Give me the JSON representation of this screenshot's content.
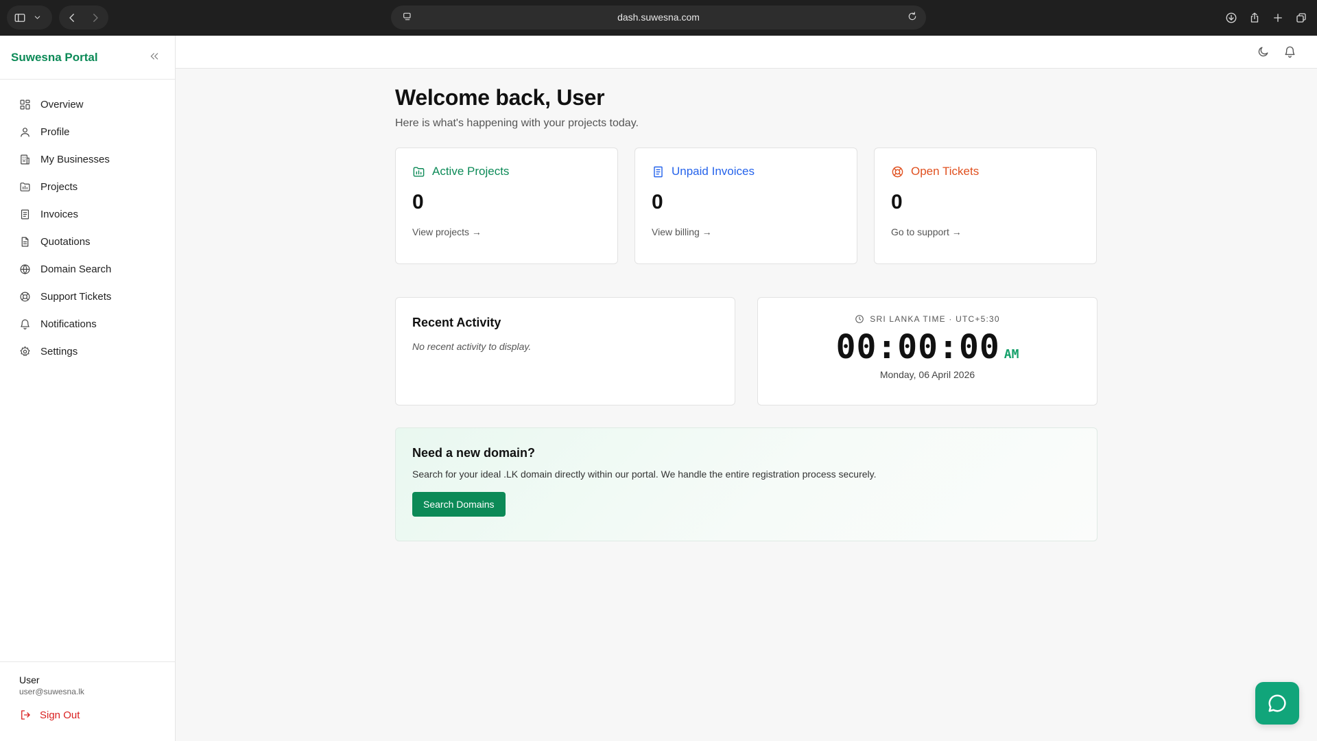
{
  "browser": {
    "url": "dash.suwesna.com"
  },
  "sidebar": {
    "brand": "Suwesna Portal",
    "items": [
      {
        "label": "Overview",
        "icon": "grid-icon"
      },
      {
        "label": "Profile",
        "icon": "user-icon"
      },
      {
        "label": "My Businesses",
        "icon": "building-icon"
      },
      {
        "label": "Projects",
        "icon": "folder-chart-icon"
      },
      {
        "label": "Invoices",
        "icon": "receipt-icon"
      },
      {
        "label": "Quotations",
        "icon": "document-icon"
      },
      {
        "label": "Domain Search",
        "icon": "globe-icon"
      },
      {
        "label": "Support Tickets",
        "icon": "lifebuoy-icon"
      },
      {
        "label": "Notifications",
        "icon": "bell-icon"
      },
      {
        "label": "Settings",
        "icon": "gear-icon"
      }
    ],
    "user_name": "User",
    "user_email": "user@suwesna.lk",
    "sign_out": "Sign Out"
  },
  "main": {
    "title": "Welcome back, User",
    "subtitle": "Here is what's happening with your projects today.",
    "cards": [
      {
        "label": "Active Projects",
        "value": "0",
        "link": "View projects →",
        "color": "#0c8a57"
      },
      {
        "label": "Unpaid Invoices",
        "value": "0",
        "link": "View billing →",
        "color": "#2563eb"
      },
      {
        "label": "Open Tickets",
        "value": "0",
        "link": "Go to support →",
        "color": "#e0501f"
      }
    ],
    "activity": {
      "title": "Recent Activity",
      "empty": "No recent activity to display."
    },
    "clock": {
      "timezone": "SRI LANKA TIME · UTC+5:30",
      "time": "00:00:00",
      "ampm": "AM",
      "date": "Monday, 06 April 2026"
    },
    "domain": {
      "title": "Need a new domain?",
      "text": "Search for your ideal .LK domain directly within our portal. We handle the entire registration process securely.",
      "button": "Search Domains"
    }
  }
}
